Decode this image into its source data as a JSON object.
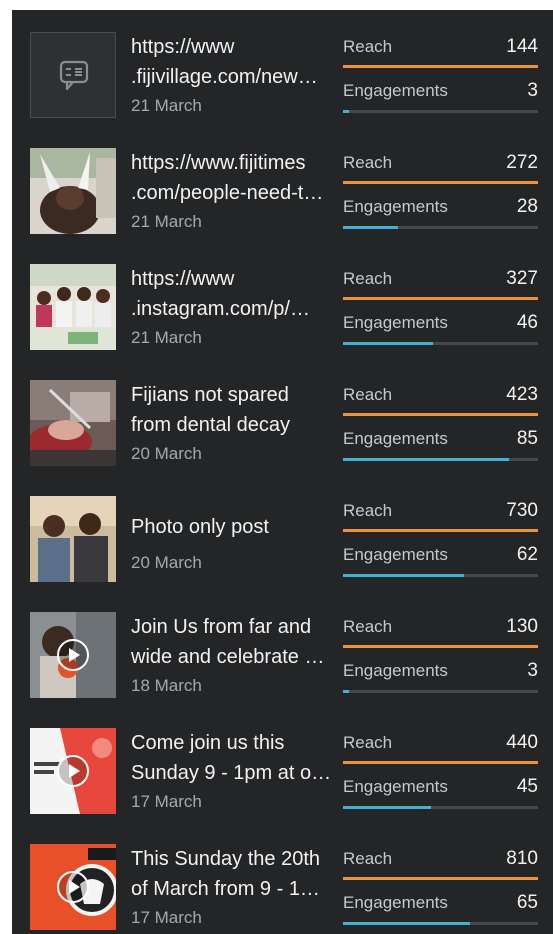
{
  "colors": {
    "panel_bg": "#242527",
    "reach_bar": "#f0923a",
    "engagement_bar": "#3fb2d6",
    "track": "#47484b"
  },
  "posts": [
    {
      "title1": "https://www",
      "title2": ".fijivillage.com/new…",
      "date": "21 March",
      "reach_label": "Reach",
      "reach": "144",
      "reach_fill": 1.0,
      "eng_label": "Engagements",
      "engagements": "3",
      "eng_fill": 0.03,
      "thumb_icon": "comment-icon"
    },
    {
      "title1": "https://www.fijitimes",
      "title2": ".com/people-need-t…",
      "date": "21 March",
      "reach_label": "Reach",
      "reach": "272",
      "reach_fill": 1.0,
      "eng_label": "Engagements",
      "engagements": "28",
      "eng_fill": 0.28,
      "thumb_icon": "photo-thumbnail"
    },
    {
      "title1": "https://www",
      "title2": ".instagram.com/p/…",
      "date": "21 March",
      "reach_label": "Reach",
      "reach": "327",
      "reach_fill": 1.0,
      "eng_label": "Engagements",
      "engagements": "46",
      "eng_fill": 0.46,
      "thumb_icon": "photo-thumbnail"
    },
    {
      "title1": "Fijians not spared",
      "title2": "from dental decay",
      "date": "20 March",
      "reach_label": "Reach",
      "reach": "423",
      "reach_fill": 1.0,
      "eng_label": "Engagements",
      "engagements": "85",
      "eng_fill": 0.85,
      "thumb_icon": "photo-thumbnail"
    },
    {
      "title1": "Photo only post",
      "title2": "",
      "date": "20 March",
      "reach_label": "Reach",
      "reach": "730",
      "reach_fill": 1.0,
      "eng_label": "Engagements",
      "engagements": "62",
      "eng_fill": 0.62,
      "thumb_icon": "photo-thumbnail"
    },
    {
      "title1": "Join Us from far and",
      "title2": "wide and celebrate …",
      "date": "18 March",
      "reach_label": "Reach",
      "reach": "130",
      "reach_fill": 1.0,
      "eng_label": "Engagements",
      "engagements": "3",
      "eng_fill": 0.03,
      "thumb_icon": "video-thumbnail"
    },
    {
      "title1": "Come join us this",
      "title2": "Sunday 9 - 1pm at o…",
      "date": "17 March",
      "reach_label": "Reach",
      "reach": "440",
      "reach_fill": 1.0,
      "eng_label": "Engagements",
      "engagements": "45",
      "eng_fill": 0.45,
      "thumb_icon": "video-thumbnail"
    },
    {
      "title1": "This Sunday the 20th",
      "title2": "of March from 9 - 1…",
      "date": "17 March",
      "reach_label": "Reach",
      "reach": "810",
      "reach_fill": 1.0,
      "eng_label": "Engagements",
      "engagements": "65",
      "eng_fill": 0.65,
      "thumb_icon": "video-thumbnail"
    }
  ]
}
